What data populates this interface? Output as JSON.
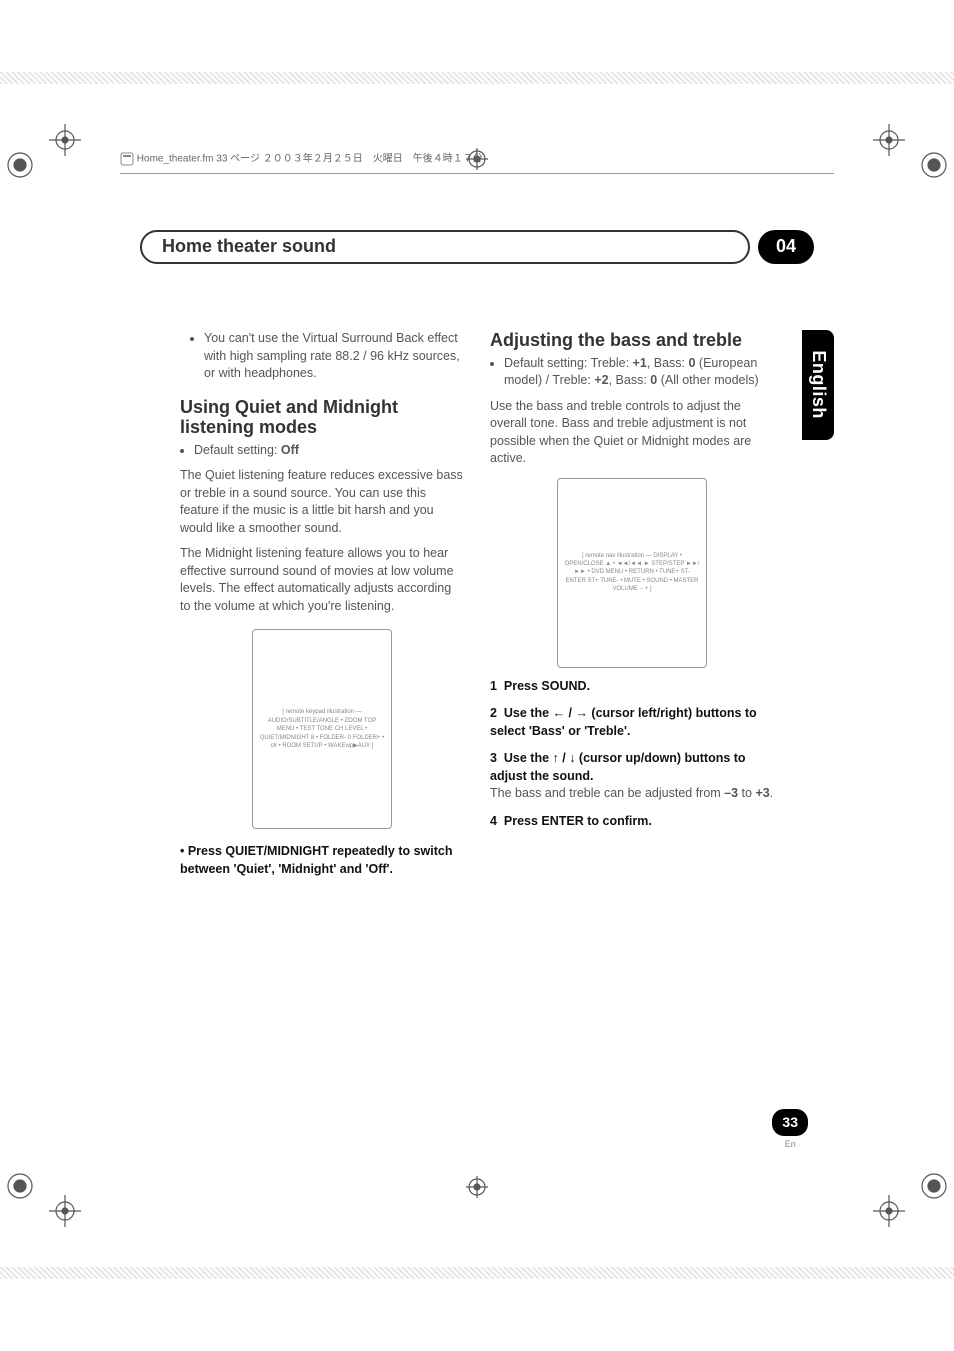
{
  "header": {
    "line": "Home_theater.fm 33 ページ ２００３年２月２５日　火曜日　午後４時１７分"
  },
  "title": {
    "text": "Home theater sound",
    "number": "04"
  },
  "side_tab": "English",
  "page": {
    "number": "33",
    "lang": "En"
  },
  "left": {
    "note_bullets": [
      "You can't use the Virtual Surround Back effect with high sampling rate 88.2 / 96 kHz sources, or with headphones."
    ],
    "h2": "Using Quiet and Midnight listening modes",
    "default_label": "Default setting: ",
    "default_value": "Off",
    "p1": "The Quiet listening feature reduces excessive bass or treble in a sound source. You can use this feature if the music is a little bit harsh and you would like a smoother sound.",
    "p2": "The Midnight listening feature allows you to hear effective surround sound of movies at low volume levels. The effect automatically adjusts according to the volume at which you're listening.",
    "remote_placeholder": "[ remote keypad illustration — AUDIO/SUBTITLE/ANGLE • ZOOM TOP MENU • TEST TONE CH LEVEL • QUIET/MIDNIGHT 8 • FOLDER- 0 FOLDER+ • clr • ROOM SETUP • WAKEwp▶AUX ]",
    "step_bullet_label": "•   Press QUIET/MIDNIGHT repeatedly to switch between 'Quiet', 'Midnight' and 'Off'."
  },
  "right": {
    "h2": "Adjusting the bass and treble",
    "default_label": "Default setting: Treble: ",
    "default_values": {
      "t1": "+1",
      "bass_lbl": ",  Bass: ",
      "b1": "0",
      "eu": " (European model) / Treble: ",
      "t2": "+2",
      "bass_lbl2": ", Bass: ",
      "b2": "0",
      "tail": " (All other models)"
    },
    "intro": "Use the bass and treble controls to adjust the overall tone. Bass and treble adjustment is not possible when the Quiet or Midnight modes are active.",
    "remote_placeholder": "[ remote nav illustration — DISPLAY • OPEN/CLOSE ▲ • ◄◄/◄◄ ► STEP/STEP ►►/►► • DVD MENU • RETURN • TUNE+ ST- ENTER ST+ TUNE- • MUTE • SOUND • MASTER VOLUME − + ]",
    "steps": [
      {
        "n": "1",
        "bold": "Press SOUND."
      },
      {
        "n": "2",
        "bold": "Use the ← / → (cursor left/right) buttons to select 'Bass' or 'Treble'."
      },
      {
        "n": "3",
        "bold": "Use the ↑ / ↓ (cursor up/down) buttons to adjust the sound.",
        "sub_a": "The bass and treble can be adjusted from ",
        "sub_b": "–3",
        "sub_c": " to ",
        "sub_d": "+3",
        "sub_e": "."
      },
      {
        "n": "4",
        "bold": "Press ENTER to confirm."
      }
    ]
  }
}
